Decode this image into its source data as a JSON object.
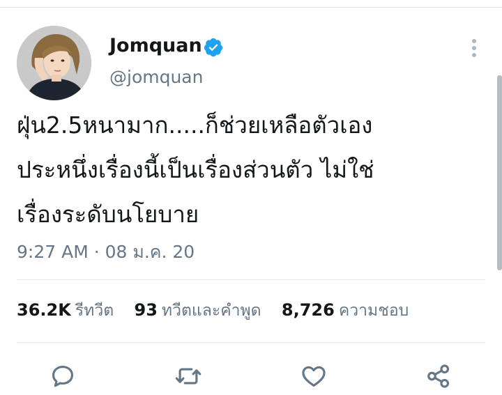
{
  "tweet": {
    "display_name": "Jomquan",
    "handle": "@jomquan",
    "text_lines": [
      "ฝุ่น2.5หนามาก.....ก็ช่วยเหลือตัวเอง",
      "ประหนึ่งเรื่องนี้เป็นเรื่องส่วนตัว ไม่ใช่",
      "เรื่องระดับนโยบาย"
    ],
    "timestamp": "9:27 AM · 08 ม.ค. 20",
    "stats": {
      "retweets_count": "36.2K",
      "retweets_label": "รีทวีต",
      "quotes_count": "93",
      "quotes_label": "ทวีตและคำพูด",
      "likes_count": "8,726",
      "likes_label": "ความชอบ"
    }
  },
  "colors": {
    "verified": "#1da1f2",
    "text_primary": "#14171a",
    "text_secondary": "#657786",
    "icon": "#657786"
  },
  "icons": {
    "verified": "verified-badge-icon",
    "more": "more-vertical-icon",
    "reply": "reply-icon",
    "retweet": "retweet-icon",
    "like": "heart-icon",
    "share": "share-icon"
  }
}
